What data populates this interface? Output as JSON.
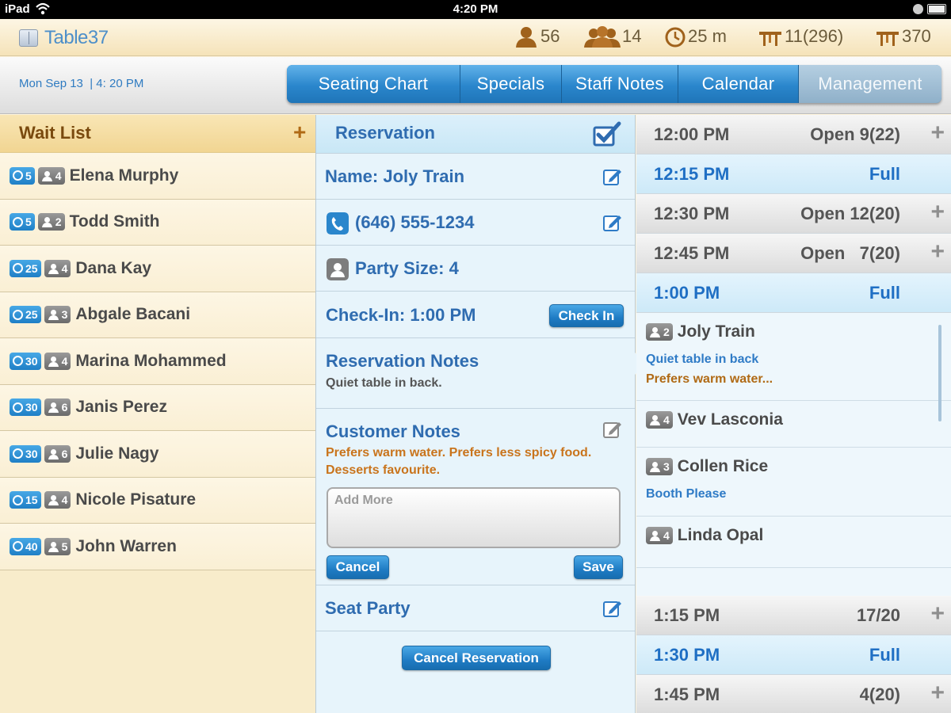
{
  "status_bar": {
    "device": "iPad",
    "time": "4:20 PM"
  },
  "header": {
    "app_name": "Table37",
    "stats": [
      {
        "icon": "person-icon",
        "value": "56"
      },
      {
        "icon": "group-icon",
        "value": "14"
      },
      {
        "icon": "clock-icon",
        "value": "25 m"
      },
      {
        "icon": "table-icon",
        "value": "11(296)"
      },
      {
        "icon": "table-icon",
        "value": "370"
      }
    ]
  },
  "nav": {
    "date": "Mon Sep 13",
    "time": "4: 20 PM",
    "tabs": [
      "Seating Chart",
      "Specials",
      "Staff Notes",
      "Calendar",
      "Management"
    ],
    "active_tab": "Management"
  },
  "waitlist": {
    "title": "Wait List",
    "add_label": "+",
    "rows": [
      {
        "wait": "5",
        "party": "4",
        "name": "Elena Murphy"
      },
      {
        "wait": "5",
        "party": "2",
        "name": "Todd Smith"
      },
      {
        "wait": "25",
        "party": "4",
        "name": "Dana Kay"
      },
      {
        "wait": "25",
        "party": "3",
        "name": "Abgale Bacani"
      },
      {
        "wait": "30",
        "party": "4",
        "name": "Marina Mohammed"
      },
      {
        "wait": "30",
        "party": "6",
        "name": "Janis Perez"
      },
      {
        "wait": "30",
        "party": "6",
        "name": "Julie Nagy"
      },
      {
        "wait": "15",
        "party": "4",
        "name": "Nicole Pisature"
      },
      {
        "wait": "40",
        "party": "5",
        "name": "John Warren"
      }
    ]
  },
  "reservation": {
    "title": "Reservation",
    "name_label": "Name: Joly Train",
    "phone": "(646) 555-1234",
    "party_size": "Party Size: 4",
    "checkin_label": "Check-In: 1:00 PM",
    "checkin_button": "Check In",
    "res_notes_title": "Reservation Notes",
    "res_notes_text": "Quiet table in back.",
    "customer_notes_title": "Customer Notes",
    "customer_notes_text": "Prefers warm water. Prefers less spicy food. Desserts favourite.",
    "add_more_placeholder": "Add More",
    "cancel_button": "Cancel",
    "save_button": "Save",
    "seat_party": "Seat Party",
    "cancel_reservation": "Cancel Reservation"
  },
  "timeslots": [
    {
      "time": "12:00 PM",
      "status": "Open 9(22)",
      "type": "open"
    },
    {
      "time": "12:15 PM",
      "status": "Full",
      "type": "full"
    },
    {
      "time": "12:30 PM",
      "status": "Open 12(20)",
      "type": "open"
    },
    {
      "time": "12:45 PM",
      "status": "Open   7(20)",
      "type": "open"
    },
    {
      "time": "1:00 PM",
      "status": "Full",
      "type": "full"
    },
    {
      "time": "1:15 PM",
      "status": "17/20",
      "type": "open"
    },
    {
      "time": "1:30 PM",
      "status": "Full",
      "type": "full"
    },
    {
      "time": "1:45 PM",
      "status": "4(20)",
      "type": "open"
    }
  ],
  "guests_1pm": [
    {
      "party": "2",
      "name": "Joly Train",
      "note": "Quiet table in back",
      "note2": "Prefers warm water..."
    },
    {
      "party": "4",
      "name": "Vev Lasconia",
      "note": "",
      "note2": ""
    },
    {
      "party": "3",
      "name": "Collen Rice",
      "note": "Booth Please",
      "note2": ""
    },
    {
      "party": "4",
      "name": "Linda Opal",
      "note": "",
      "note2": ""
    }
  ],
  "colors": {
    "accent_blue": "#2f6cb0",
    "brown_text": "#7a4a0e",
    "orange_note": "#b06a15"
  }
}
